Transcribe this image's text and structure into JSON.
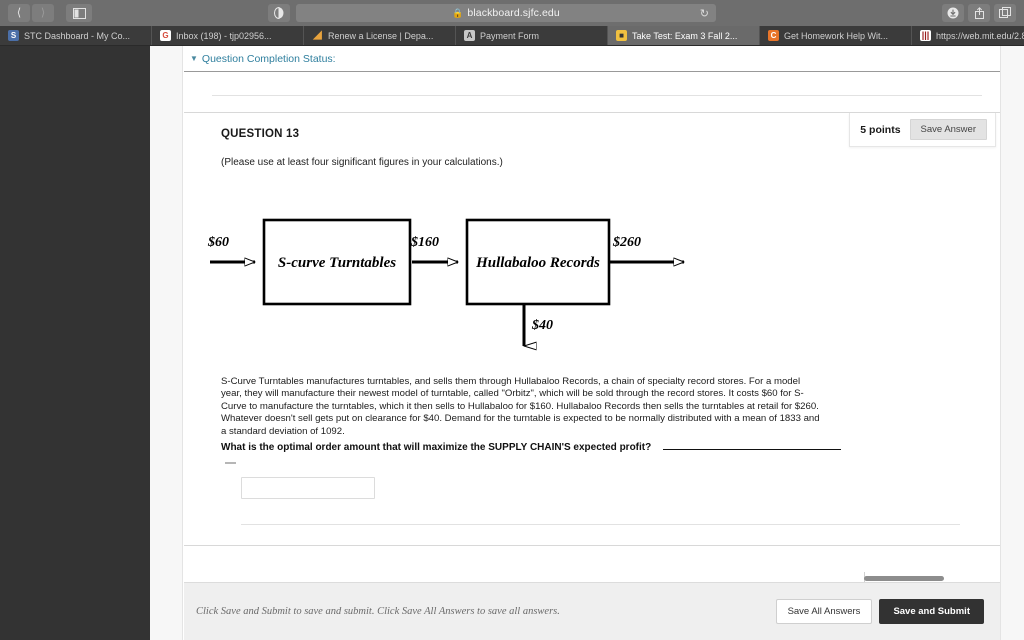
{
  "browser": {
    "url": "blackboard.sjfc.edu",
    "lock_icon": "lock-icon",
    "back_icon": "back-arrow-icon",
    "forward_icon": "forward-arrow-icon",
    "sidebar_icon": "sidebar-toggle-icon",
    "reader_icon": "reader-view-icon",
    "reload_icon": "reload-icon",
    "download_icon": "download-icon",
    "share_icon": "share-icon",
    "tabs_overview_icon": "tabs-overview-icon",
    "new_tab_label": "+",
    "tabs": [
      {
        "label": "STC Dashboard - My Co...",
        "favicon_text": "S",
        "favicon_color": "#4b6fa8",
        "active": false
      },
      {
        "label": "Inbox (198) - tjp02956...",
        "favicon_text": "G",
        "favicon_color": "#ffffff",
        "active": false
      },
      {
        "label": "Renew a License | Depa...",
        "favicon_text": "◢",
        "favicon_color": "#e8a33d",
        "active": false
      },
      {
        "label": "Payment Form",
        "favicon_text": "A",
        "favicon_color": "#c8c8c8",
        "active": false
      },
      {
        "label": "Take Test: Exam 3 Fall 2...",
        "favicon_text": "▣",
        "favicon_color": "#f0c040",
        "active": true
      },
      {
        "label": "Get Homework Help Wit...",
        "favicon_text": "C",
        "favicon_color": "#e8752a",
        "active": false
      },
      {
        "label": "https://web.mit.edu/2.81...",
        "favicon_text": "|||",
        "favicon_color": "#ffffff",
        "active": false
      }
    ]
  },
  "completion": {
    "chevron_icon": "chevron-down-icon",
    "label": "Question Completion Status:"
  },
  "question": {
    "title": "QUESTION 13",
    "points": "5 points",
    "save_answer_label": "Save Answer",
    "instruction": "(Please use at least four significant figures in your calculations.)",
    "paragraph": "S-Curve Turntables manufactures turntables, and sells them through Hullabaloo Records, a chain of specialty record stores.  For a model year, they will manufacture their newest model of turntable, called \"Orbitz\",  which will be sold through the record stores.  It costs $60 for S-Curve to manufacture the turntables, which it then sells to Hullabaloo for $160.  Hullabaloo Records then sells the turntables at retail for $260.  Whatever doesn't sell gets put on clearance for $40.  Demand for the turntable is expected to be normally distributed with a mean of 1833 and a standard deviation of 1092.",
    "prompt": "What is the optimal order amount that will maximize the SUPPLY CHAIN'S expected profit?",
    "answer_value": "",
    "answer_placeholder": ""
  },
  "diagram": {
    "node_1": "S-curve Turntables",
    "node_2": "Hullabaloo Records",
    "label_in": "$60",
    "label_mid": "$160",
    "label_out": "$260",
    "label_clearance": "$40"
  },
  "footer": {
    "note": "Click Save and Submit to save and submit. Click Save All Answers to save all answers.",
    "save_all_label": "Save All Answers",
    "save_submit_label": "Save and Submit"
  }
}
